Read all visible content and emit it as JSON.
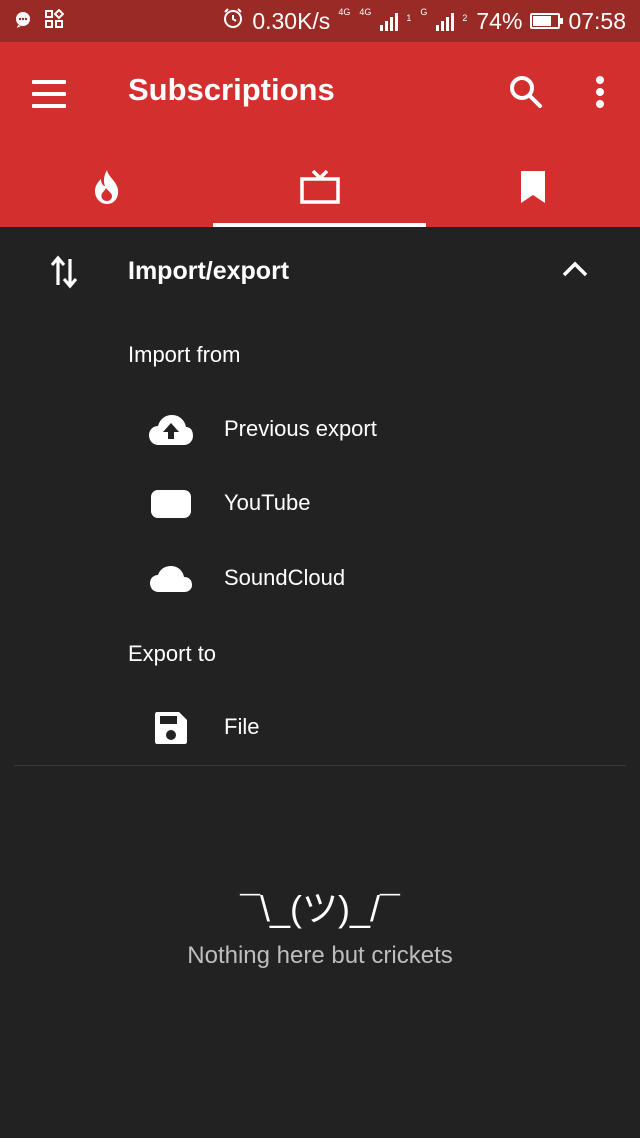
{
  "status_bar": {
    "speed": "0.30K/s",
    "network_primary": "4G",
    "network_secondary": "4G",
    "sim1_label": "1",
    "sim2_tag": "G",
    "sim2_label": "2",
    "battery_percent": "74%",
    "battery_level": 0.74,
    "time": "07:58"
  },
  "toolbar": {
    "title": "Subscriptions",
    "menu_icon": "hamburger-menu-icon",
    "search_icon": "search-icon",
    "more_icon": "more-vert-icon"
  },
  "tabs": [
    {
      "icon": "trending-fire-icon",
      "selected": false
    },
    {
      "icon": "tv-icon",
      "selected": true
    },
    {
      "icon": "bookmark-icon",
      "selected": false
    }
  ],
  "import_export": {
    "title": "Import/export",
    "expanded": true,
    "import_from_label": "Import from",
    "import_items": [
      {
        "label": "Previous export",
        "icon": "cloud-upload-icon"
      },
      {
        "label": "YouTube",
        "icon": "youtube-icon"
      },
      {
        "label": "SoundCloud",
        "icon": "cloud-icon"
      }
    ],
    "export_to_label": "Export to",
    "export_items": [
      {
        "label": "File",
        "icon": "save-icon"
      }
    ]
  },
  "empty_state": {
    "emoji": "¯\\_(ツ)_/¯",
    "message": "Nothing here but crickets"
  },
  "colors": {
    "app_bar": "#d32f2f",
    "status_bar": "#992a25",
    "background": "#222222",
    "text_secondary": "#bdbdbd"
  }
}
